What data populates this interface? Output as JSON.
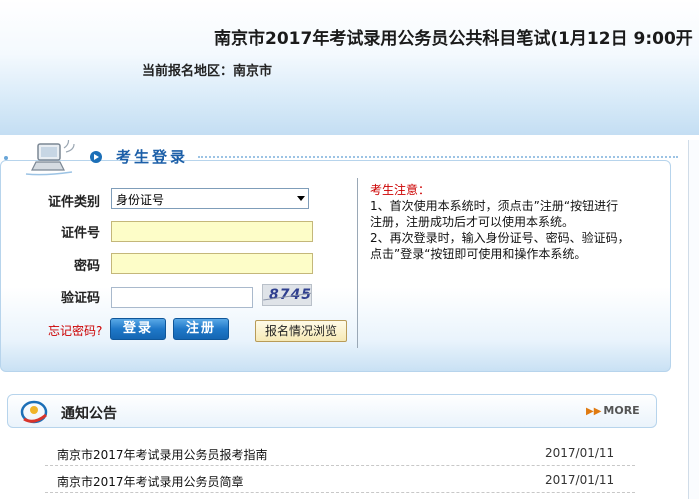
{
  "header": {
    "exam_title": "南京市2017年考试录用公务员公共科目笔试(1月12日 9:00开",
    "region_label": "当前报名地区：南京市"
  },
  "login": {
    "title": "考生登录",
    "id_type_label": "证件类别",
    "id_type_value": "身份证号",
    "id_number_label": "证件号",
    "password_label": "密码",
    "captcha_label": "验证码",
    "captcha_text": "8745",
    "forgot_label": "忘记密码?",
    "login_button": "登录",
    "register_button": "注册",
    "browse_button": "报名情况浏览"
  },
  "notice": {
    "title": "考生注意：",
    "lines": [
      "1、首次使用本系统时，须点击”注册“按钮进行",
      "注册，注册成功后才可以使用本系统。",
      "2、再次登录时，输入身份证号、密码、验证码，",
      "点击”登录“按钮即可使用和操作本系统。"
    ]
  },
  "announcements": {
    "title": "通知公告",
    "more_label": "MORE",
    "items": [
      {
        "title": "南京市2017年考试录用公务员报考指南",
        "date": "2017/01/11"
      },
      {
        "title": "南京市2017年考试录用公务员简章",
        "date": "2017/01/11"
      }
    ]
  },
  "colors": {
    "accent_blue": "#1c6fb7",
    "warning_red": "#cc0000",
    "input_yellow": "#fdfdc8"
  }
}
